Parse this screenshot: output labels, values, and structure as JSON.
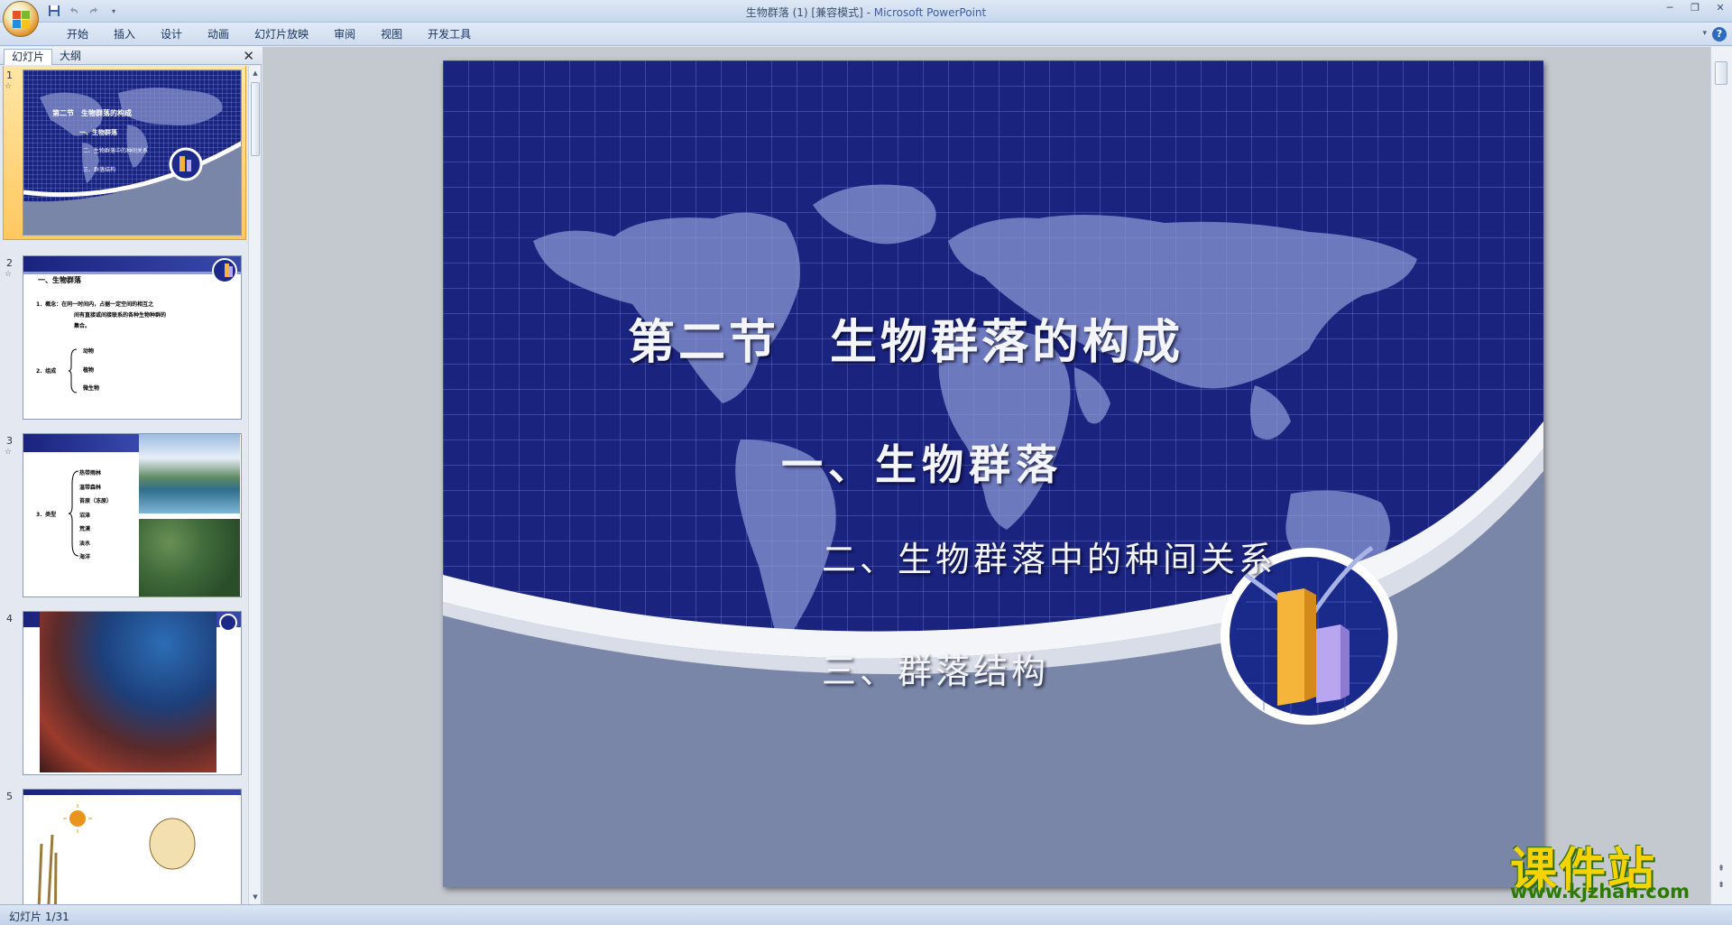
{
  "window": {
    "title_doc": "生物群落 (1) [兼容模式] - ",
    "title_app": "Microsoft PowerPoint"
  },
  "menu": {
    "tabs": [
      "开始",
      "插入",
      "设计",
      "动画",
      "幻灯片放映",
      "审阅",
      "视图",
      "开发工具"
    ]
  },
  "panel": {
    "tab_slides": "幻灯片",
    "tab_outline": "大纲",
    "thumbnails": [
      {
        "num": "1",
        "title": "第二节　生物群落的构成",
        "items": [
          "一、生物群落",
          "二、生物群落中的种间关系",
          "三、群落结构"
        ]
      },
      {
        "num": "2",
        "heading": "一、生物群落",
        "line1": "1．概念：在同一时间内，占据一定空间的相互之",
        "line2": "间有直接或间接联系的各种生物种群的",
        "line3": "集合。",
        "label": "2．组成",
        "items": [
          "动物",
          "植物",
          "微生物"
        ]
      },
      {
        "num": "3",
        "label": "3．类型",
        "items": [
          "热带雨林",
          "温带森林",
          "苔原（冻原）",
          "沼泽",
          "荒漠",
          "淡水",
          "海洋"
        ]
      },
      {
        "num": "4"
      },
      {
        "num": "5"
      }
    ]
  },
  "slide": {
    "title": "第二节　生物群落的构成",
    "item1": "一、生物群落",
    "item2": "二、生物群落中的种间关系",
    "item3": "三、群落结构"
  },
  "status": {
    "text": "幻灯片 1/31"
  },
  "watermark": {
    "title": "课件站",
    "url": "www.kjzhan.com"
  },
  "colors": {
    "slide_bg": "#1a237e",
    "selection": "#ffc860",
    "wave": "#7986a8"
  }
}
